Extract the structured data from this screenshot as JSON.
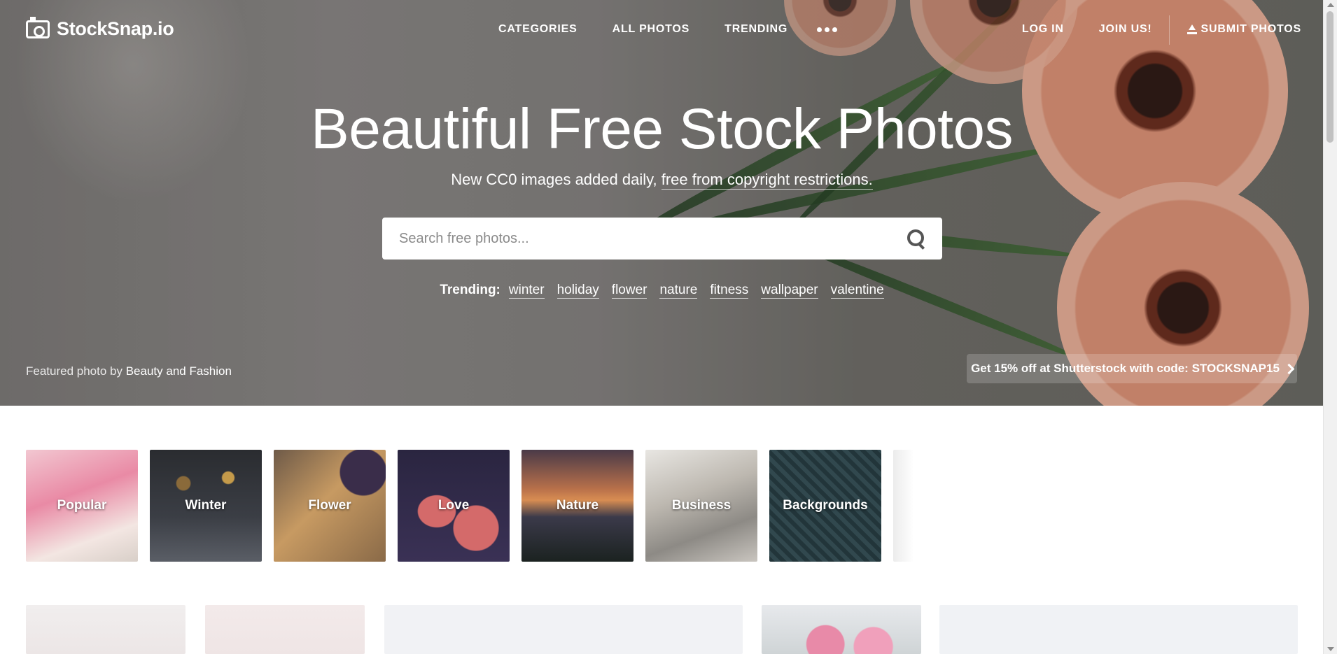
{
  "brand": {
    "name": "StockSnap.io"
  },
  "nav": {
    "center": [
      "CATEGORIES",
      "ALL PHOTOS",
      "TRENDING"
    ],
    "right": {
      "login": "LOG IN",
      "join": "JOIN US!",
      "submit": "SUBMIT PHOTOS"
    }
  },
  "hero": {
    "title": "Beautiful Free Stock Photos",
    "subtitle_prefix": "New CC0 images added daily, ",
    "subtitle_link": "free from copyright restrictions.",
    "search_placeholder": "Search free photos...",
    "trending_label": "Trending:",
    "trending_tags": [
      "winter",
      "holiday",
      "flower",
      "nature",
      "fitness",
      "wallpaper",
      "valentine"
    ],
    "featured_prefix": "Featured photo by",
    "featured_author": "Beauty and Fashion",
    "promo": "Get 15% off at Shutterstock with code: STOCKSNAP15"
  },
  "categories": [
    "Popular",
    "Winter",
    "Flower",
    "Love",
    "Nature",
    "Business",
    "Backgrounds"
  ],
  "colors": {
    "hero_overlay": "#7d7a78",
    "accent_flower": "#e39477"
  }
}
